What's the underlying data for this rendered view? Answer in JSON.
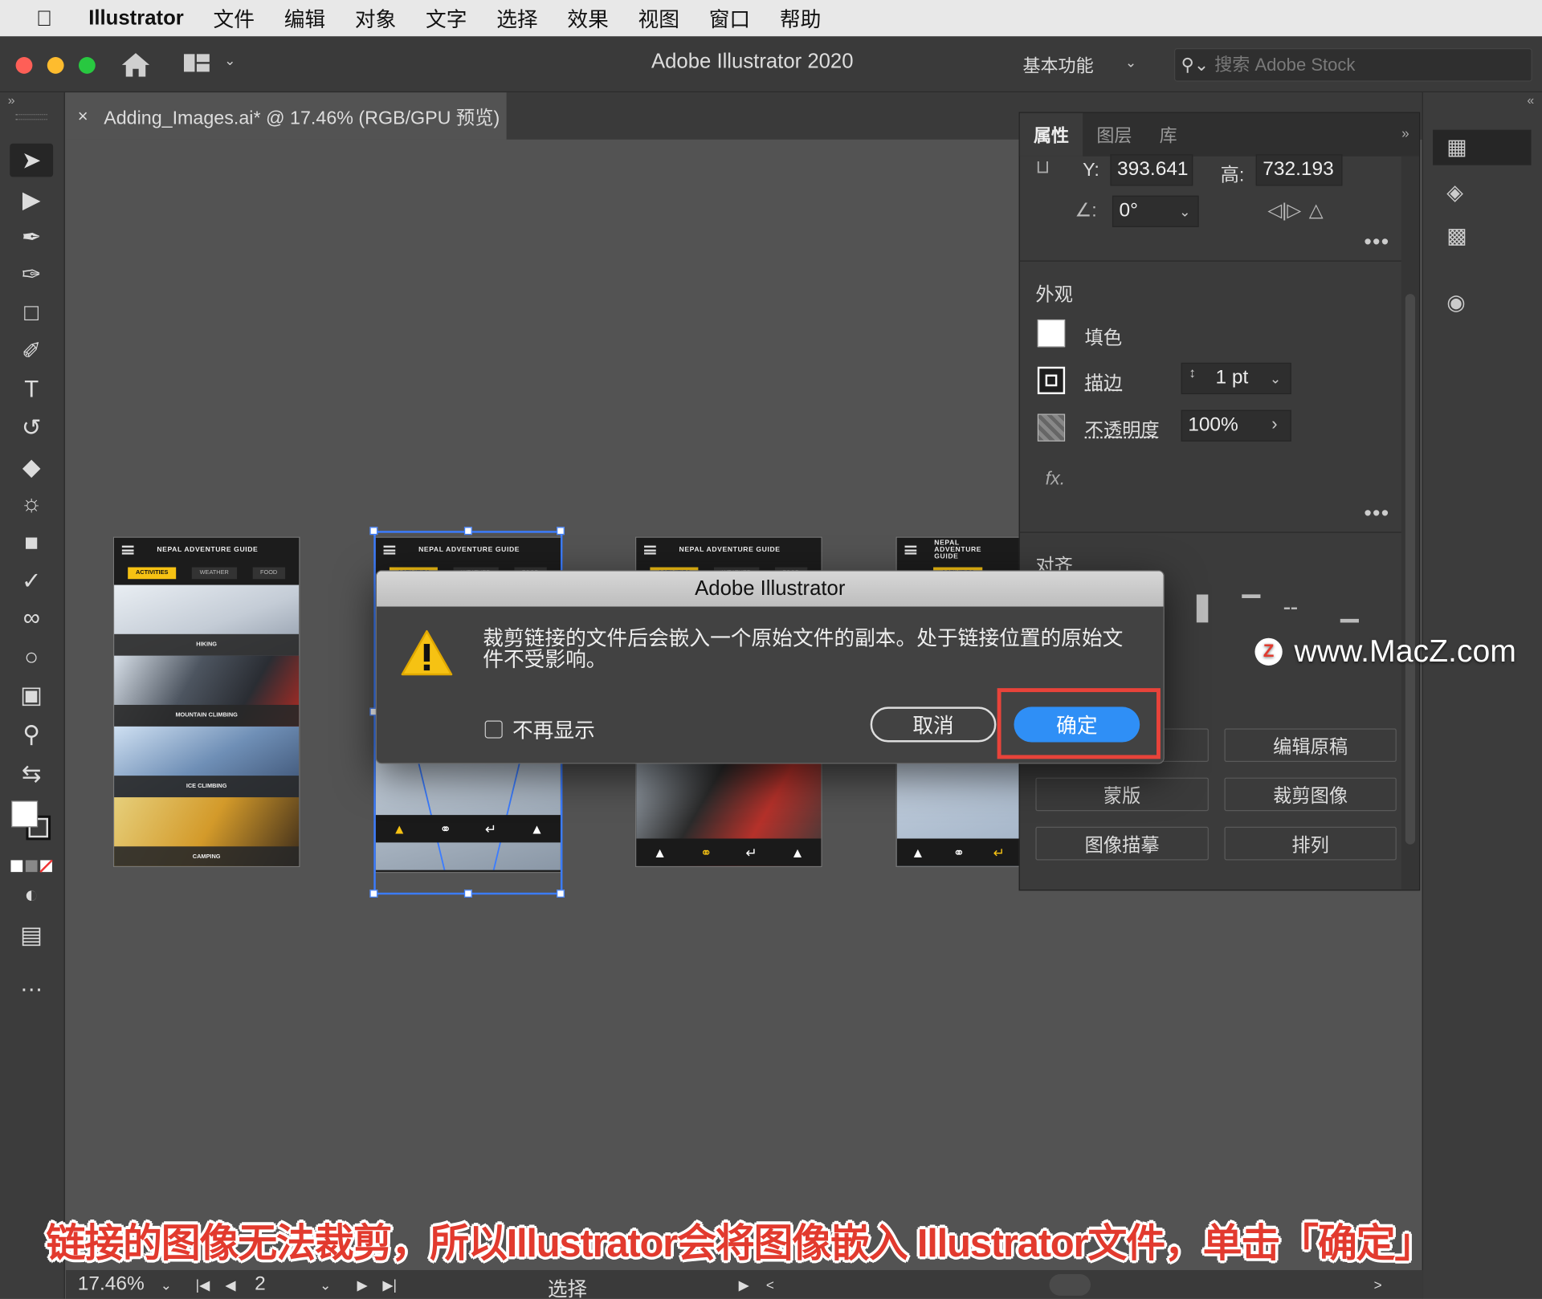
{
  "menubar": {
    "app_name": "Illustrator",
    "items": [
      "文件",
      "编辑",
      "对象",
      "文字",
      "选择",
      "效果",
      "视图",
      "窗口",
      "帮助"
    ]
  },
  "titlebar": {
    "title": "Adobe Illustrator 2020",
    "workspace": "基本功能",
    "stock_search_placeholder": "搜索 Adobe Stock"
  },
  "document_tab": {
    "label": "Adding_Images.ai* @ 17.46% (RGB/GPU 预览)"
  },
  "artboards": {
    "title": "NEPAL ADVENTURE GUIDE",
    "tabs": [
      "ACTIVITIES",
      "WEATHER",
      "FOOD"
    ],
    "labels": [
      "HIKING",
      "MOUNTAIN CLIMBING",
      "ICE CLIMBING",
      "CAMPING"
    ]
  },
  "properties_panel": {
    "tabs": [
      "属性",
      "图层",
      "库"
    ],
    "y_label": "Y:",
    "y_value": "393.641",
    "h_label": "高:",
    "h_value": "732.193",
    "angle_value": "0°",
    "appearance_heading": "外观",
    "fill_label": "填色",
    "stroke_label": "描边",
    "stroke_value": "1 pt",
    "opacity_label": "不透明度",
    "opacity_value": "100%",
    "fx_label": "fx.",
    "align_heading": "对齐",
    "buttons": [
      "编辑原稿",
      "蒙版",
      "裁剪图像",
      "图像描摹",
      "排列"
    ]
  },
  "status_bar": {
    "zoom": "17.46%",
    "artboard_number": "2",
    "tool": "选择"
  },
  "dialog": {
    "title": "Adobe Illustrator",
    "message": "裁剪链接的文件后会嵌入一个原始文件的副本。处于链接位置的原始文件不受影响。",
    "checkbox_label": "不再显示",
    "cancel_label": "取消",
    "ok_label": "确定"
  },
  "watermark": "www.MacZ.com",
  "caption": "链接的图像无法裁剪，所以Illustrator会将图像嵌入 Illustrator文件，单击「确定」",
  "colors": {
    "ok_button": "#2f8ff6",
    "highlight": "#e8433a",
    "caption": "#e23a2e",
    "selection": "#3b7cff"
  }
}
